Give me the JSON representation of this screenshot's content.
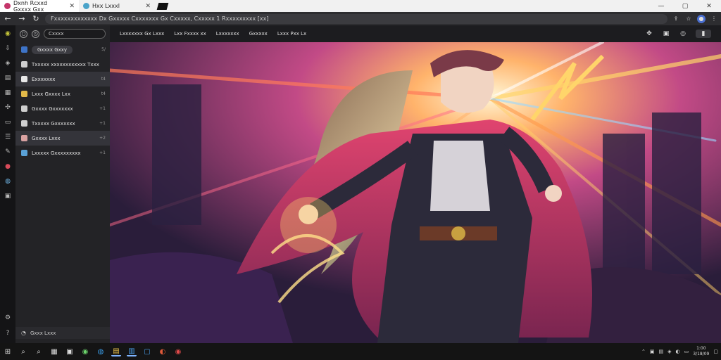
{
  "browser": {
    "tabs": [
      {
        "title": "Dxnh Rcxxd Gxxxx Gxx",
        "close": "✕",
        "active": true,
        "color": "#c4356a"
      },
      {
        "title": "Hxx Lxxxl",
        "close": "✕",
        "active": false,
        "color": "#4aa3c9"
      }
    ],
    "window_controls": [
      "—",
      "▢",
      "✕"
    ],
    "nav": {
      "back": "←",
      "forward": "→",
      "reload": "↻"
    },
    "url": "Fxxxxxxxxxxxxx Dx Gxxxxx Cxxxxxxx Gx Cxxxxx, Cxxxxx 1 Rxxxxxxxxx [xx]"
  },
  "rail": {
    "icons": [
      "shield-icon",
      "download-icon",
      "cube-icon",
      "document-icon",
      "grid-icon",
      "puzzle-icon",
      "chat-icon",
      "list-icon",
      "paint-icon",
      "record-icon",
      "globe-icon",
      "sidebar-icon"
    ],
    "bottom_icons": [
      "settings-icon",
      "help-icon"
    ]
  },
  "sidebar": {
    "search_placeholder": "Cxxxx",
    "items": [
      {
        "label": "Gxxxx Gxxy",
        "count": "5/",
        "color": "#3e74c8"
      },
      {
        "label": "Txxxxx xxxxxxxxxxxx Txxx",
        "count": "",
        "color": "#cfcfcf"
      },
      {
        "label": "Exxxxxxx",
        "count": "t4",
        "color": "#e8e8e8"
      },
      {
        "label": "Lxxx Gxxxx Lxx",
        "count": "t4",
        "color": "#e2b949"
      },
      {
        "label": "Gxxxx Gxxxxxxx",
        "count": "+1",
        "color": "#cfcfcf"
      },
      {
        "label": "Txxxxx Gxxxxxxx",
        "count": "+1",
        "color": "#cfcfcf"
      },
      {
        "label": "Gxxxx Lxxx",
        "count": "+2",
        "color": "#d9a2a2"
      },
      {
        "label": "Lxxxxx Gxxxxxxxxx",
        "count": "+1",
        "color": "#5aa1d6"
      }
    ],
    "footer": "Gxxx Lxxx"
  },
  "toolbar": {
    "items": [
      "Lxxxxxxx Gx Lxxx",
      "Lxx Fxxxx xx",
      "Lxxxxxxx",
      "Gxxxxx",
      "Lxxx Pxx   Lx"
    ],
    "right_icons": [
      "✥",
      "▣",
      "◎",
      "▮"
    ]
  },
  "taskbar": {
    "icons": [
      "⊞",
      "⌕",
      "⌕",
      "▦",
      "▣",
      "◉",
      "◍",
      "▤",
      "▥",
      "▢",
      "◐",
      "◉"
    ],
    "tray": [
      "⌃",
      "▣",
      "▤",
      "◈",
      "◐",
      "▭"
    ],
    "clock_time": "1:00",
    "clock_date": "3/18/09"
  },
  "colors": {
    "accent": "#e0446f",
    "glow": "#ffd56a"
  }
}
